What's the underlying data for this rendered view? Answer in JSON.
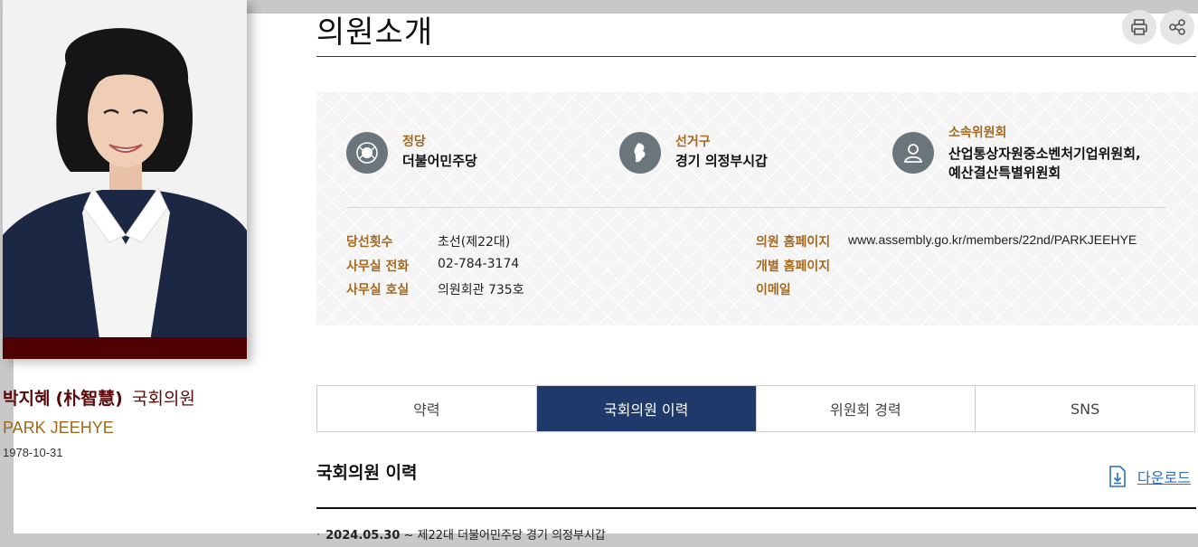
{
  "member": {
    "name_korean": "박지혜",
    "name_hanja": "(朴智慧)",
    "role": "국회의원",
    "name_english": "PARK JEEHYE",
    "birth_date": "1978-10-31"
  },
  "header": {
    "title": "의원소개",
    "print_icon": "print-icon",
    "share_icon": "share-icon"
  },
  "summary": {
    "party": {
      "label": "정당",
      "value": "더불어민주당",
      "icon": "emblem-icon"
    },
    "district": {
      "label": "선거구",
      "value": "경기 의정부시갑",
      "icon": "map-icon"
    },
    "committee": {
      "label": "소속위원회",
      "value_line1": "산업통상자원중소벤처기업위원회,",
      "value_line2": "예산결산특별위원회",
      "icon": "person-icon"
    }
  },
  "details_left": [
    {
      "label": "당선횟수",
      "value": "초선(제22대)"
    },
    {
      "label": "사무실 전화",
      "value": "02-784-3174"
    },
    {
      "label": "사무실 호실",
      "value": "의원회관 735호"
    }
  ],
  "details_right": [
    {
      "label": "의원 홈페이지",
      "value": "www.assembly.go.kr/members/22nd/PARKJEEHYE"
    },
    {
      "label": "개별 홈페이지",
      "value": ""
    },
    {
      "label": "이메일",
      "value": ""
    }
  ],
  "tabs": [
    {
      "label": "약력",
      "active": false
    },
    {
      "label": "국회의원 이력",
      "active": true
    },
    {
      "label": "위원회 경력",
      "active": false
    },
    {
      "label": "SNS",
      "active": false
    }
  ],
  "section": {
    "title": "국회의원 이력",
    "download_label": "다운로드",
    "download_icon": "download-icon"
  },
  "history": [
    {
      "bullet": "·",
      "date": "2024.05.30",
      "text": " ~ 제22대 더불어민주당 경기 의정부시갑"
    }
  ],
  "colors": {
    "accent_navy": "#1f3a6a",
    "label_gold": "#a3691e",
    "name_maroon": "#5a0a0a",
    "photo_bar": "#4f0003",
    "link_blue": "#2a6fc2"
  }
}
